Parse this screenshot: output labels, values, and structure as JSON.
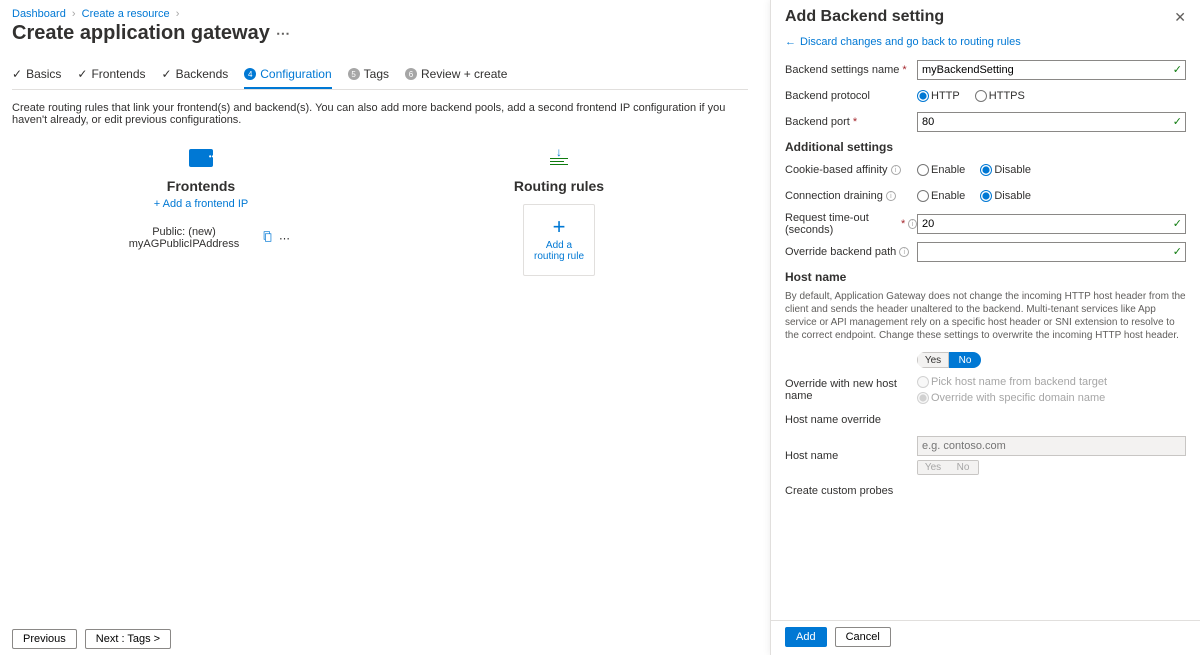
{
  "breadcrumb": {
    "dashboard": "Dashboard",
    "create_resource": "Create a resource"
  },
  "page_title": "Create application gateway",
  "tabs": {
    "basics": "Basics",
    "frontends": "Frontends",
    "backends": "Backends",
    "configuration": "Configuration",
    "tags": "Tags",
    "review": "Review + create"
  },
  "intro": "Create routing rules that link your frontend(s) and backend(s). You can also add more backend pools, add a second frontend IP configuration if you haven't already, or edit previous configurations.",
  "frontends": {
    "title": "Frontends",
    "add_link": "+ Add a frontend IP",
    "item": "Public: (new) myAGPublicIPAddress"
  },
  "rules": {
    "title": "Routing rules",
    "card_text": "Add a routing rule"
  },
  "buttons": {
    "previous": "Previous",
    "next": "Next : Tags >"
  },
  "panel": {
    "title": "Add Backend setting",
    "back": "Discard changes and go back to routing rules",
    "labels": {
      "name": "Backend settings name",
      "protocol": "Backend protocol",
      "port": "Backend port",
      "additional": "Additional settings",
      "affinity": "Cookie-based affinity",
      "draining": "Connection draining",
      "timeout": "Request time-out (seconds)",
      "override_path": "Override backend path",
      "hostname": "Host name",
      "override_new": "Override with new host name",
      "override_title": "Host name override",
      "hostname2": "Host name",
      "probes": "Create custom probes"
    },
    "values": {
      "name": "myBackendSetting",
      "port": "80",
      "timeout": "20",
      "hostname_placeholder": "e.g. contoso.com"
    },
    "radios": {
      "http": "HTTP",
      "https": "HTTPS",
      "enable": "Enable",
      "disable": "Disable",
      "pick": "Pick host name from backend target",
      "specific": "Override with specific domain name",
      "yes": "Yes",
      "no": "No"
    },
    "desc": "By default, Application Gateway does not change the incoming HTTP host header from the client and sends the header unaltered to the backend. Multi-tenant services like App service or API management rely on a specific host header or SNI extension to resolve to the correct endpoint. Change these settings to overwrite the incoming HTTP host header.",
    "footer": {
      "add": "Add",
      "cancel": "Cancel"
    }
  }
}
